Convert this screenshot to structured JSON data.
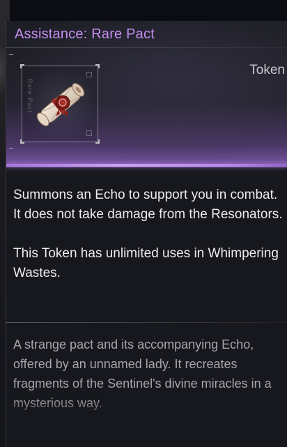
{
  "item": {
    "title": "Assistance: Rare Pact",
    "type_label": "Token",
    "icon": "scroll-pact-icon",
    "frame_text": "Rare Pact",
    "description": [
      "Summons an Echo to support you in combat. It does not take damage from the Resonators.",
      "This Token has unlimited uses in Whimpering Wastes."
    ],
    "lore": "A strange pact and its accompanying Echo, offered by an unnamed lady. It recreates fragments of the Sentinel's divine miracles in a mysterious way."
  },
  "colors": {
    "title": "#c58df2",
    "accent_line": "#b58ae6",
    "description_text": "#ececef",
    "lore_text": "#a6a6ad",
    "panel_bg": "#17181d"
  }
}
